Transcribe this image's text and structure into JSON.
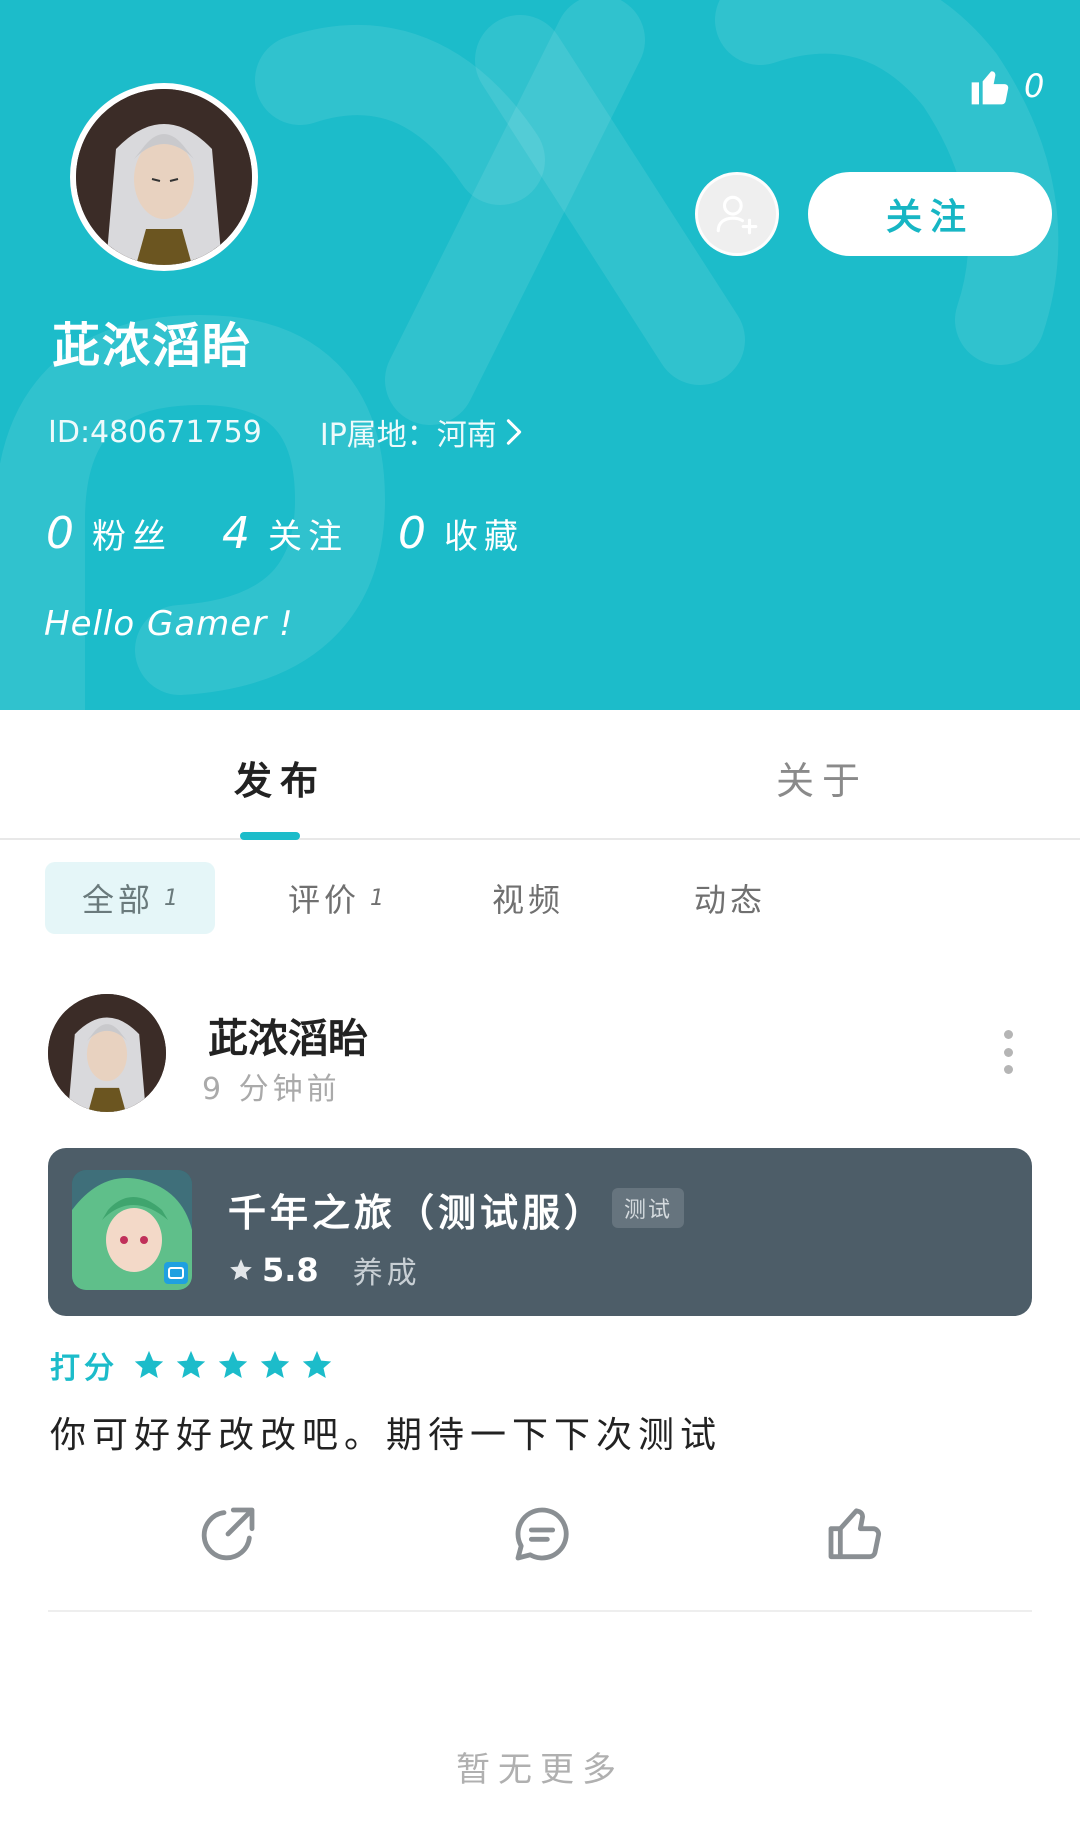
{
  "header": {
    "like_count": "0",
    "follow_label": "关注",
    "username": "茈浓滔眙",
    "user_id": "ID:480671759",
    "ip_location": "IP属地：河南",
    "stats": [
      {
        "value": "0",
        "label": "粉丝"
      },
      {
        "value": "4",
        "label": "关注"
      },
      {
        "value": "0",
        "label": "收藏"
      }
    ],
    "bio": "Hello Gamer !",
    "background_color": "#1cbcca"
  },
  "tabs": {
    "main": [
      {
        "label": "发布",
        "active": true
      },
      {
        "label": "关于",
        "active": false
      }
    ],
    "sub": [
      {
        "label": "全部",
        "badge": "1",
        "active": true
      },
      {
        "label": "评价",
        "badge": "1",
        "active": false
      },
      {
        "label": "视频",
        "badge": "",
        "active": false
      },
      {
        "label": "动态",
        "badge": "",
        "active": false
      }
    ]
  },
  "post": {
    "author": "茈浓滔眙",
    "time": "9 分钟前",
    "game": {
      "title": "千年之旅（测试服）",
      "tag": "测试",
      "score": "5.8",
      "genre": "养成"
    },
    "rating_label": "打分",
    "rating_stars": 5,
    "review": "你可好好改改吧。期待一下下次测试"
  },
  "footer": {
    "no_more": "暂无更多"
  },
  "colors": {
    "accent": "#1cbcca",
    "card": "#4d5d68"
  }
}
